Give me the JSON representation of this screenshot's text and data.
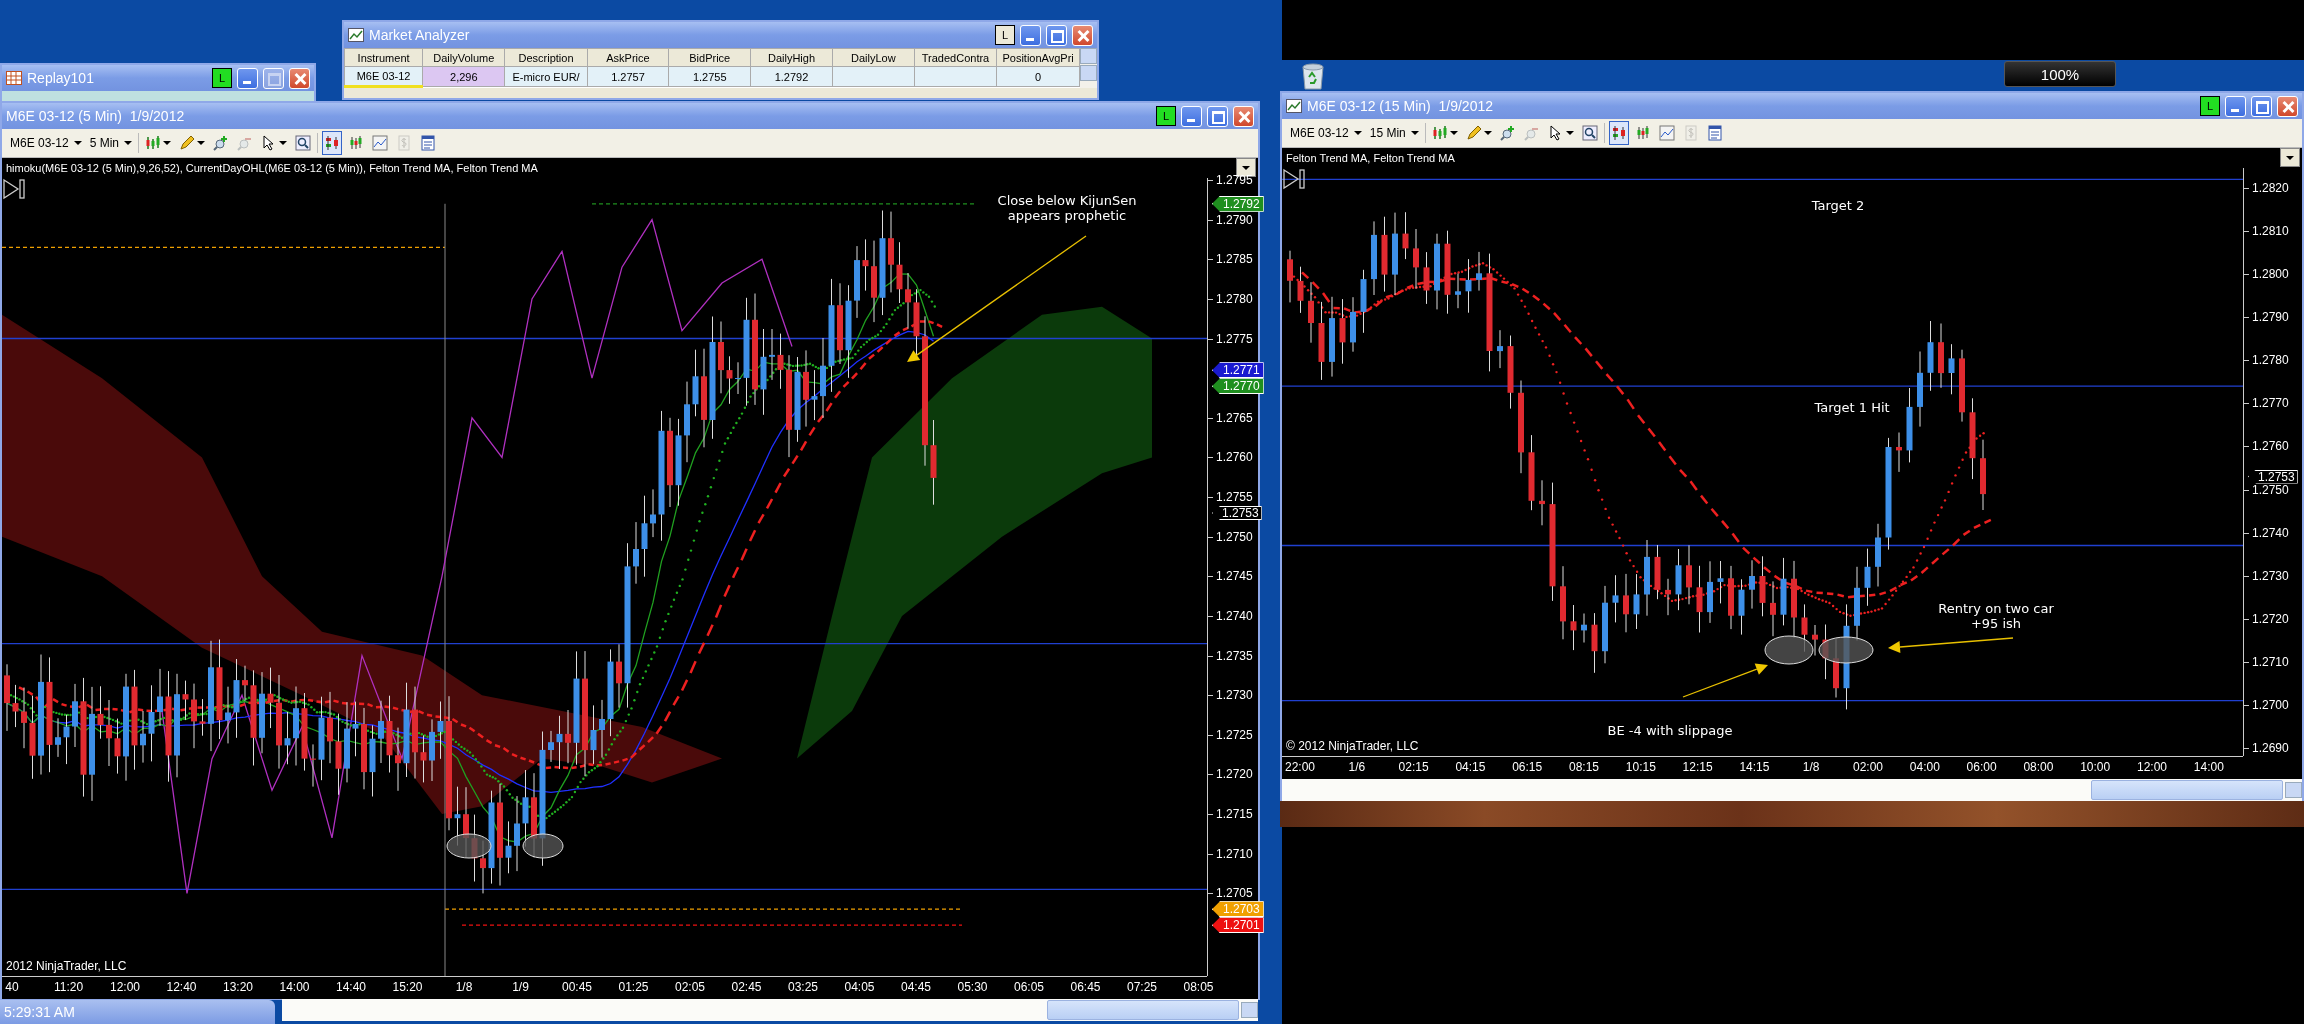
{
  "desktop": {
    "zoom_indicator": "100%",
    "clock": "5:29:31 AM"
  },
  "replay_window": {
    "title": "Replay101",
    "lock_label": "L",
    "maximize_enabled": false
  },
  "market_analyzer": {
    "title": "Market Analyzer",
    "lock_label": "L",
    "maximize_enabled": true,
    "columns": [
      "Instrument",
      "DailyVolume",
      "Description",
      "AskPrice",
      "BidPrice",
      "DailyHigh",
      "DailyLow",
      "TradedContra",
      "PositionAvgPri"
    ],
    "rows": [
      [
        "M6E 03-12",
        "2,296",
        "E-micro EUR/",
        "1.2757",
        "1.2755",
        "1.2792",
        null,
        null,
        "0"
      ]
    ]
  },
  "charts": [
    {
      "title": "M6E 03-12 (5 Min)  1/9/2012",
      "title_icon": false,
      "lock_label": "L",
      "maximize_enabled": true,
      "instrument": "M6E 03-12",
      "interval": "5 Min",
      "toolbar": [
        {
          "kind": "bars",
          "menu": true,
          "pressed": false,
          "disabled": false
        },
        {
          "kind": "pencil",
          "menu": true,
          "pressed": false,
          "disabled": false
        },
        {
          "kind": "zoom_in",
          "menu": false,
          "pressed": false,
          "disabled": false
        },
        {
          "kind": "zoom_out",
          "menu": false,
          "pressed": false,
          "disabled": true
        },
        {
          "kind": "pointer",
          "menu": true,
          "pressed": false,
          "disabled": false
        },
        {
          "kind": "magnifier",
          "menu": false,
          "pressed": false,
          "disabled": false
        },
        {
          "kind": "data_box",
          "menu": false,
          "pressed": true,
          "disabled": false
        },
        {
          "kind": "candles",
          "menu": false,
          "pressed": false,
          "disabled": false
        },
        {
          "kind": "line_chart",
          "menu": false,
          "pressed": false,
          "disabled": false
        },
        {
          "kind": "dollar",
          "menu": false,
          "pressed": false,
          "disabled": true
        },
        {
          "kind": "properties",
          "menu": false,
          "pressed": false,
          "disabled": false
        }
      ],
      "indicators": "himoku(M6E 03-12 (5 Min),9,26,52), CurrentDayOHL(M6E 03-12 (5 Min)), Felton Trend MA, Felton Trend MA",
      "copyright": "2012 NinjaTrader, LLC",
      "price_labels": [
        "1.2795",
        "1.2790",
        "1.2785",
        "1.2780",
        "1.2775",
        "1.2765",
        "1.2760",
        "1.2755",
        "1.2750",
        "1.2745",
        "1.2740",
        "1.2735",
        "1.2730",
        "1.2725",
        "1.2720",
        "1.2715",
        "1.2710",
        "1.2705"
      ],
      "price_flags": [
        {
          "text": "1.2792",
          "color": "#1f8f1f"
        },
        {
          "text": "1.2771",
          "color": "#1a1ad0"
        },
        {
          "text": "1.2770",
          "color": "#1f8f1f"
        },
        {
          "text": "1.2753",
          "color": "#000000"
        },
        {
          "text": "1.2703",
          "color": "#f0a000"
        },
        {
          "text": "1.2701",
          "color": "#ee1111"
        }
      ],
      "time_labels": [
        "40",
        "11:20",
        "12:00",
        "12:40",
        "13:20",
        "14:00",
        "14:40",
        "15:20",
        "1/8",
        "1/9",
        "00:45",
        "01:25",
        "02:05",
        "02:45",
        "03:25",
        "04:05",
        "04:45",
        "05:30",
        "06:05",
        "06:45",
        "07:25",
        "08:05"
      ],
      "annotations": [
        {
          "text": "Close below KijunSen\nappears prophetic"
        }
      ]
    },
    {
      "title": "M6E 03-12 (15 Min)  1/9/2012",
      "title_icon": true,
      "lock_label": "L",
      "maximize_enabled": true,
      "instrument": "M6E 03-12",
      "interval": "15 Min",
      "toolbar": [
        {
          "kind": "bars",
          "menu": true,
          "pressed": false,
          "disabled": false
        },
        {
          "kind": "pencil",
          "menu": true,
          "pressed": false,
          "disabled": false
        },
        {
          "kind": "zoom_in",
          "menu": false,
          "pressed": false,
          "disabled": false
        },
        {
          "kind": "zoom_out",
          "menu": false,
          "pressed": false,
          "disabled": true
        },
        {
          "kind": "pointer",
          "menu": true,
          "pressed": false,
          "disabled": false
        },
        {
          "kind": "magnifier",
          "menu": false,
          "pressed": false,
          "disabled": false
        },
        {
          "kind": "data_box",
          "menu": false,
          "pressed": true,
          "disabled": false
        },
        {
          "kind": "candles",
          "menu": false,
          "pressed": false,
          "disabled": false
        },
        {
          "kind": "line_chart",
          "menu": false,
          "pressed": false,
          "disabled": false
        },
        {
          "kind": "dollar",
          "menu": false,
          "pressed": false,
          "disabled": true
        },
        {
          "kind": "properties",
          "menu": false,
          "pressed": false,
          "disabled": false
        }
      ],
      "indicators": "Felton Trend MA, Felton Trend MA",
      "copyright": "© 2012 NinjaTrader, LLC",
      "price_labels": [
        "1.2820",
        "1.2810",
        "1.2800",
        "1.2790",
        "1.2780",
        "1.2770",
        "1.2760",
        "1.2750",
        "1.2740",
        "1.2730",
        "1.2720",
        "1.2710",
        "1.2700",
        "1.2690"
      ],
      "price_flags": [
        {
          "text": "1.2753",
          "color": "#000000"
        }
      ],
      "time_labels": [
        "22:00",
        "1/6",
        "02:15",
        "04:15",
        "06:15",
        "08:15",
        "10:15",
        "12:15",
        "14:15",
        "1/8",
        "02:00",
        "04:00",
        "06:00",
        "08:00",
        "10:00",
        "12:00",
        "14:00"
      ],
      "annotations": [
        {
          "text": "Target 2"
        },
        {
          "text": "Target 1 Hit"
        },
        {
          "text": "Rentry on two car\n+95 ish"
        },
        {
          "text": "BE -4 with slippage"
        }
      ]
    }
  ]
}
